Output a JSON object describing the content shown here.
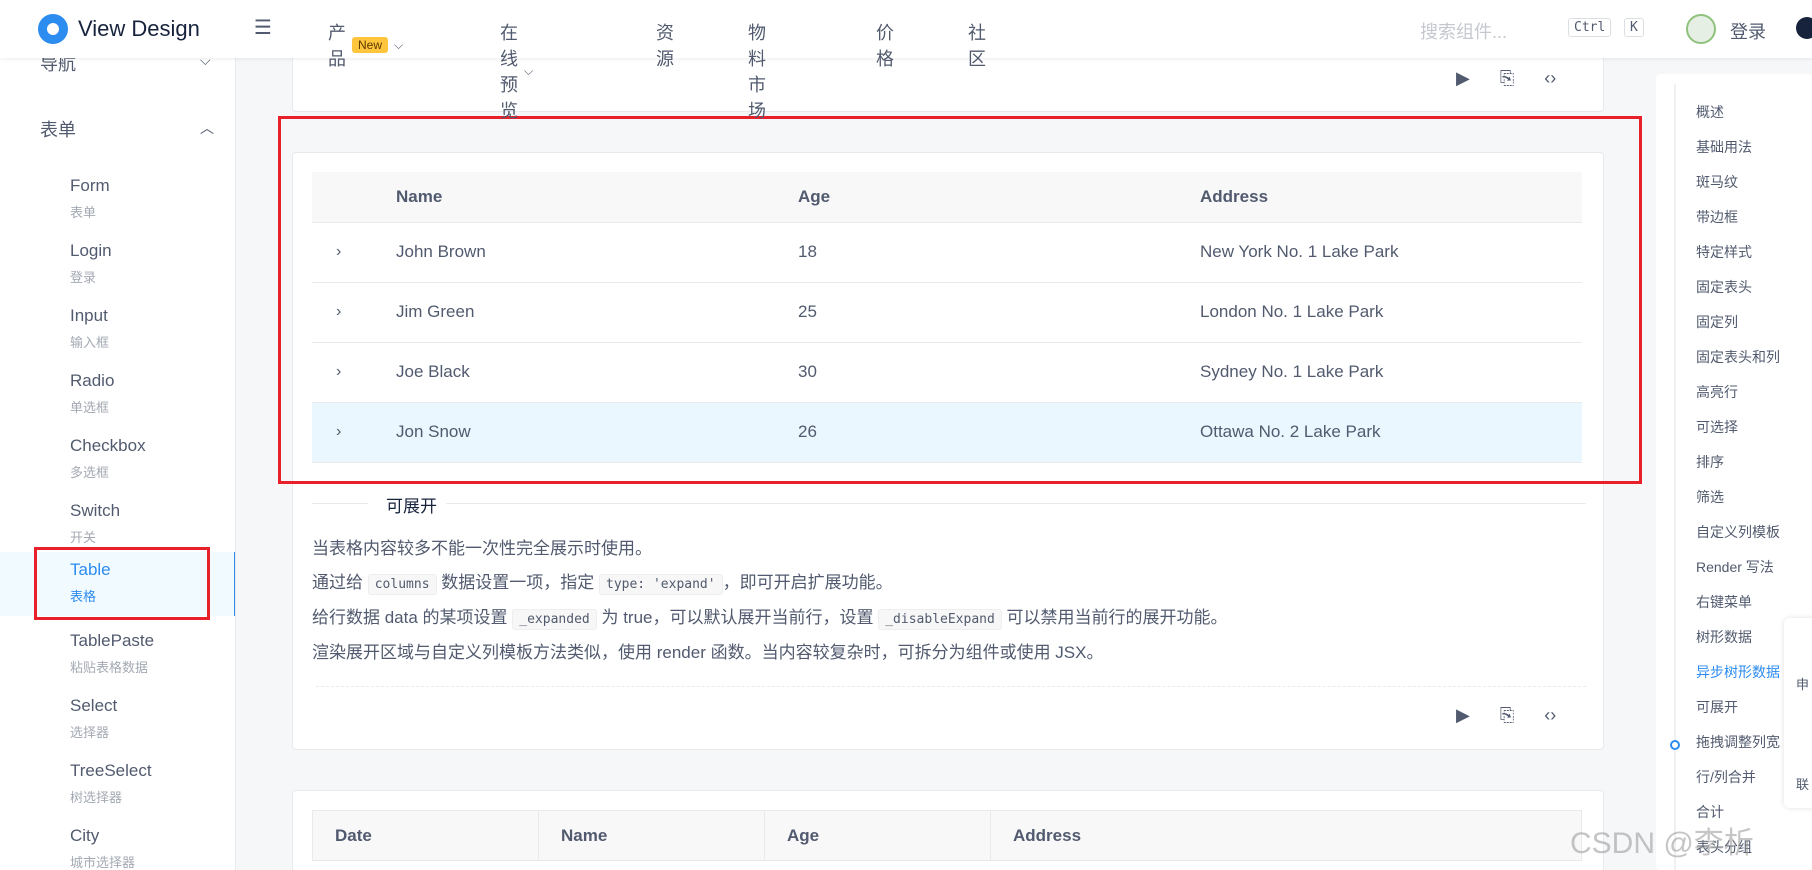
{
  "header": {
    "brand": "View Design",
    "nav": [
      {
        "label": "产品",
        "badge": "New"
      },
      {
        "label": "在线预览"
      },
      {
        "label": "资源"
      },
      {
        "label": "物料市场"
      },
      {
        "label": "价格"
      },
      {
        "label": "社区"
      }
    ],
    "search_placeholder": "搜索组件...",
    "kbd": [
      "Ctrl",
      "K"
    ],
    "login": "登录"
  },
  "sidebar": {
    "groups": [
      {
        "title": "导航",
        "expanded": false
      },
      {
        "title": "表单",
        "expanded": true
      }
    ],
    "items": [
      {
        "en": "Form",
        "zh": "表单"
      },
      {
        "en": "Login",
        "zh": "登录"
      },
      {
        "en": "Input",
        "zh": "输入框"
      },
      {
        "en": "Radio",
        "zh": "单选框"
      },
      {
        "en": "Checkbox",
        "zh": "多选框"
      },
      {
        "en": "Switch",
        "zh": "开关"
      },
      {
        "en": "Table",
        "zh": "表格",
        "active": true
      },
      {
        "en": "TablePaste",
        "zh": "粘贴表格数据"
      },
      {
        "en": "Select",
        "zh": "选择器"
      },
      {
        "en": "TreeSelect",
        "zh": "树选择器"
      },
      {
        "en": "City",
        "zh": "城市选择器"
      }
    ]
  },
  "table": {
    "columns": [
      "Name",
      "Age",
      "Address"
    ],
    "rows": [
      {
        "name": "John Brown",
        "age": "18",
        "address": "New York No. 1 Lake Park"
      },
      {
        "name": "Jim Green",
        "age": "25",
        "address": "London No. 1 Lake Park"
      },
      {
        "name": "Joe Black",
        "age": "30",
        "address": "Sydney No. 1 Lake Park"
      },
      {
        "name": "Jon Snow",
        "age": "26",
        "address": "Ottawa No. 2 Lake Park"
      }
    ]
  },
  "section": {
    "title": "可展开",
    "line1": "当表格内容较多不能一次性完全展示时使用。",
    "line2_a": "通过给",
    "line2_code1": "columns",
    "line2_b": "数据设置一项，指定",
    "line2_code2": "type: 'expand'",
    "line2_c": "，即可开启扩展功能。",
    "line3_a": "给行数据 data 的某项设置",
    "line3_code1": "_expanded",
    "line3_b": "为 true，可以默认展开当前行，设置",
    "line3_code2": "_disableExpand",
    "line3_c": "可以禁用当前行的展开功能。",
    "line4": "渲染展开区域与自定义列模板方法类似，使用 render 函数。当内容较复杂时，可拆分为组件或使用 JSX。"
  },
  "table2": {
    "columns": [
      "Date",
      "Name",
      "Age",
      "Address"
    ]
  },
  "anchor": {
    "items": [
      "概述",
      "基础用法",
      "斑马纹",
      "带边框",
      "特定样式",
      "固定表头",
      "固定列",
      "固定表头和列",
      "高亮行",
      "可选择",
      "排序",
      "筛选",
      "自定义列模板",
      "Render 写法",
      "右键菜单",
      "树形数据",
      "异步树形数据",
      "可展开",
      "拖拽调整列宽",
      "行/列合并",
      "合计",
      "表头分组"
    ],
    "active": "异步树形数据"
  },
  "float_panel": [
    "申",
    "联"
  ],
  "watermark": "CSDN @李析"
}
